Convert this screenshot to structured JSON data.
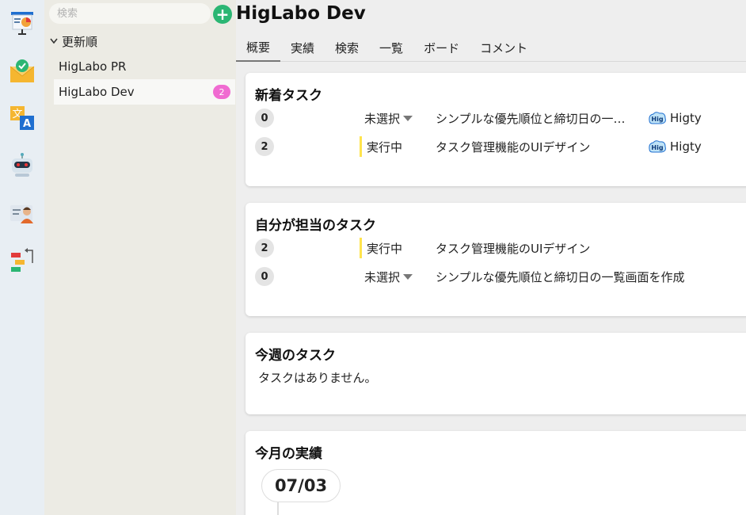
{
  "rail": {
    "apps": [
      {
        "icon": "presentation-chart-icon"
      },
      {
        "icon": "mail-check-icon"
      },
      {
        "icon": "translate-icon"
      },
      {
        "icon": "robot-icon"
      },
      {
        "icon": "user-card-icon"
      },
      {
        "icon": "flowchart-icon"
      }
    ]
  },
  "sidebar": {
    "search_placeholder": "検索",
    "sort_label": "更新順",
    "projects": [
      {
        "name": "HigLabo PR",
        "badge": ""
      },
      {
        "name": "HigLabo Dev",
        "badge": "2"
      }
    ]
  },
  "header": {
    "title": "HigLabo Dev",
    "tabs": [
      "概要",
      "実績",
      "検索",
      "一覧",
      "ボード",
      "コメント"
    ]
  },
  "sections": {
    "new_tasks": {
      "title": "新着タスク",
      "rows": [
        {
          "count": "0",
          "status": "未選択",
          "name": "シンプルな優先順位と締切日の一…",
          "assignee": "Higty"
        },
        {
          "count": "2",
          "status": "実行中",
          "name": "タスク管理機能のUIデザイン",
          "assignee": "Higty"
        }
      ]
    },
    "my_tasks": {
      "title": "自分が担当のタスク",
      "rows": [
        {
          "count": "2",
          "status": "実行中",
          "name": "タスク管理機能のUIデザイン"
        },
        {
          "count": "0",
          "status": "未選択",
          "name": "シンプルな優先順位と締切日の一覧画面を作成"
        }
      ]
    },
    "week_tasks": {
      "title": "今週のタスク",
      "empty_text": "タスクはありません。"
    },
    "month_results": {
      "title": "今月の実績",
      "date": "07/03"
    }
  },
  "colors": {
    "accent_green": "#2bb673",
    "badge_pink": "#f06bd1",
    "status_yellow": "#ffe44d"
  }
}
